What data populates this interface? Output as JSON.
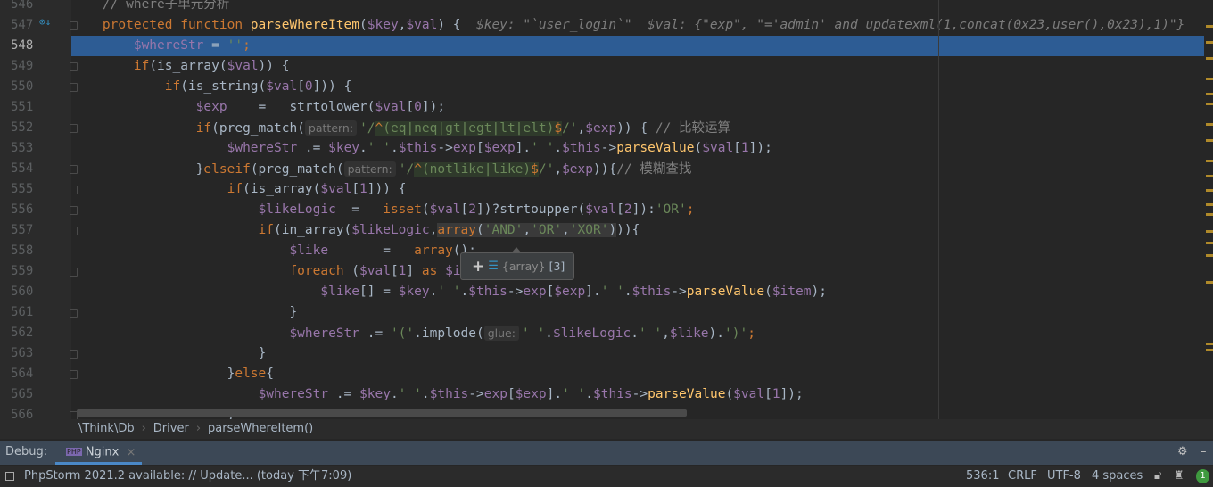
{
  "editor": {
    "first_line": 546,
    "current_line": 548,
    "lines": [
      [
        [
          "    ",
          ""
        ],
        [
          "// where子单元分析",
          "cm"
        ]
      ],
      [
        [
          "    ",
          ""
        ],
        [
          "protected function ",
          "kw"
        ],
        [
          "parseWhereItem",
          "fn"
        ],
        [
          "(",
          ""
        ],
        [
          "$key",
          "v"
        ],
        [
          ",",
          ""
        ],
        [
          "$val",
          "v"
        ],
        [
          ") {",
          ""
        ],
        [
          "  $key: \"`user_login`\"  $val: {\"exp\", \"='admin' and updatexml(1,concat(0x23,user(),0x23),1)\"}",
          "dbg"
        ]
      ],
      [
        [
          "        ",
          ""
        ],
        [
          "$whereStr",
          "v"
        ],
        [
          " = ",
          ""
        ],
        [
          "''",
          "s"
        ],
        [
          ";",
          "kw"
        ]
      ],
      [
        [
          "        ",
          ""
        ],
        [
          "if",
          "kw"
        ],
        [
          "(is_array(",
          ""
        ],
        [
          "$val",
          "v"
        ],
        [
          ")) {",
          ""
        ]
      ],
      [
        [
          "            ",
          ""
        ],
        [
          "if",
          "kw"
        ],
        [
          "(is_string(",
          ""
        ],
        [
          "$val",
          "v"
        ],
        [
          "[",
          ""
        ],
        [
          "0",
          "v"
        ],
        [
          "])) {",
          ""
        ]
      ],
      [
        [
          "                ",
          ""
        ],
        [
          "$exp",
          "v"
        ],
        [
          "    =   strtolower(",
          ""
        ],
        [
          "$val",
          "v"
        ],
        [
          "[",
          ""
        ],
        [
          "0",
          "v"
        ],
        [
          "]);",
          ""
        ]
      ],
      [
        [
          "                ",
          ""
        ],
        [
          "if",
          "kw"
        ],
        [
          "(preg_match(",
          ""
        ],
        [
          "pattern:",
          "hint"
        ],
        [
          "'/",
          "s"
        ],
        [
          "^",
          "rxo"
        ],
        [
          "(eq|neq|gt|egt|lt|elt)",
          "rx"
        ],
        [
          "$",
          "rxo"
        ],
        [
          "/'",
          "s"
        ],
        [
          ",",
          ""
        ],
        [
          "$exp",
          "v"
        ],
        [
          ")) { ",
          ""
        ],
        [
          "// 比较运算",
          "cm"
        ]
      ],
      [
        [
          "                    ",
          ""
        ],
        [
          "$whereStr",
          "v"
        ],
        [
          " .= ",
          ""
        ],
        [
          "$key",
          "v"
        ],
        [
          ".",
          ""
        ],
        [
          "' '",
          "s"
        ],
        [
          ".",
          ""
        ],
        [
          "$this",
          "v"
        ],
        [
          "->",
          ""
        ],
        [
          "exp",
          "v"
        ],
        [
          "[",
          ""
        ],
        [
          "$exp",
          "v"
        ],
        [
          "].",
          ""
        ],
        [
          "' '",
          "s"
        ],
        [
          ".",
          ""
        ],
        [
          "$this",
          "v"
        ],
        [
          "->",
          ""
        ],
        [
          "parseValue",
          "fn"
        ],
        [
          "(",
          ""
        ],
        [
          "$val",
          "v"
        ],
        [
          "[",
          ""
        ],
        [
          "1",
          "v"
        ],
        [
          "]);",
          ""
        ]
      ],
      [
        [
          "                ",
          ""
        ],
        [
          "}",
          ""
        ],
        [
          "elseif",
          "kw"
        ],
        [
          "(preg_match(",
          ""
        ],
        [
          "pattern:",
          "hint"
        ],
        [
          "'/",
          "s"
        ],
        [
          "^",
          "rxo"
        ],
        [
          "(notlike|like)",
          "rx"
        ],
        [
          "$",
          "rxo"
        ],
        [
          "/'",
          "s"
        ],
        [
          ",",
          ""
        ],
        [
          "$exp",
          "v"
        ],
        [
          ")){",
          ""
        ],
        [
          "// 模糊查找",
          "cm"
        ]
      ],
      [
        [
          "                    ",
          ""
        ],
        [
          "if",
          "kw"
        ],
        [
          "(is_array(",
          ""
        ],
        [
          "$val",
          "v"
        ],
        [
          "[",
          ""
        ],
        [
          "1",
          "v"
        ],
        [
          "])) {",
          ""
        ]
      ],
      [
        [
          "                        ",
          ""
        ],
        [
          "$likeLogic",
          "v"
        ],
        [
          "  =   ",
          ""
        ],
        [
          "isset",
          "kw"
        ],
        [
          "(",
          ""
        ],
        [
          "$val",
          "v"
        ],
        [
          "[",
          ""
        ],
        [
          "2",
          "v"
        ],
        [
          "])?strtoupper(",
          ""
        ],
        [
          "$val",
          "v"
        ],
        [
          "[",
          ""
        ],
        [
          "2",
          "v"
        ],
        [
          "]):",
          ""
        ],
        [
          "'OR'",
          "s"
        ],
        [
          ";",
          "kw"
        ]
      ],
      [
        [
          "                        ",
          ""
        ],
        [
          "if",
          "kw"
        ],
        [
          "(in_array(",
          ""
        ],
        [
          "$likeLogic",
          "v"
        ],
        [
          ",",
          ""
        ],
        [
          "array",
          "kw hl"
        ],
        [
          "(",
          "hl"
        ],
        [
          "'AND'",
          "s hl"
        ],
        [
          ",",
          "hl"
        ],
        [
          "'OR'",
          "s hl"
        ],
        [
          ",",
          "hl"
        ],
        [
          "'XOR'",
          "s hl"
        ],
        [
          ")",
          "hl"
        ],
        [
          ")){",
          ""
        ]
      ],
      [
        [
          "                            ",
          ""
        ],
        [
          "$like",
          "v"
        ],
        [
          "       =   ",
          ""
        ],
        [
          "array",
          "kw"
        ],
        [
          "();",
          ""
        ]
      ],
      [
        [
          "                            ",
          ""
        ],
        [
          "foreach",
          "kw"
        ],
        [
          " (",
          ""
        ],
        [
          "$val",
          "v"
        ],
        [
          "[",
          ""
        ],
        [
          "1",
          "v"
        ],
        [
          "] ",
          ""
        ],
        [
          "as",
          "kw"
        ],
        [
          " ",
          ""
        ],
        [
          "$item",
          "v"
        ],
        [
          ") {",
          ""
        ]
      ],
      [
        [
          "                                ",
          ""
        ],
        [
          "$like",
          "v"
        ],
        [
          "[] = ",
          ""
        ],
        [
          "$key",
          "v"
        ],
        [
          ".",
          ""
        ],
        [
          "' '",
          "s"
        ],
        [
          ".",
          ""
        ],
        [
          "$this",
          "v"
        ],
        [
          "->",
          ""
        ],
        [
          "exp",
          "v"
        ],
        [
          "[",
          ""
        ],
        [
          "$exp",
          "v"
        ],
        [
          "].",
          ""
        ],
        [
          "' '",
          "s"
        ],
        [
          ".",
          ""
        ],
        [
          "$this",
          "v"
        ],
        [
          "->",
          ""
        ],
        [
          "parseValue",
          "fn"
        ],
        [
          "(",
          ""
        ],
        [
          "$item",
          "v"
        ],
        [
          ");",
          ""
        ]
      ],
      [
        [
          "                            ",
          ""
        ],
        [
          "}",
          ""
        ]
      ],
      [
        [
          "                            ",
          ""
        ],
        [
          "$whereStr",
          "v"
        ],
        [
          " .= ",
          ""
        ],
        [
          "'('",
          "s"
        ],
        [
          ".implode(",
          ""
        ],
        [
          "glue:",
          "hint"
        ],
        [
          "' '",
          "s"
        ],
        [
          ".",
          ""
        ],
        [
          "$likeLogic",
          "v"
        ],
        [
          ".",
          ""
        ],
        [
          "' '",
          "s"
        ],
        [
          ",",
          ""
        ],
        [
          "$like",
          "v"
        ],
        [
          ").",
          ""
        ],
        [
          "')'",
          "s"
        ],
        [
          ";",
          "kw"
        ]
      ],
      [
        [
          "                        ",
          ""
        ],
        [
          "}",
          ""
        ]
      ],
      [
        [
          "                    ",
          ""
        ],
        [
          "}",
          ""
        ],
        [
          "else",
          "kw"
        ],
        [
          "{",
          ""
        ]
      ],
      [
        [
          "                        ",
          ""
        ],
        [
          "$whereStr",
          "v"
        ],
        [
          " .= ",
          ""
        ],
        [
          "$key",
          "v"
        ],
        [
          ".",
          ""
        ],
        [
          "' '",
          "s"
        ],
        [
          ".",
          ""
        ],
        [
          "$this",
          "v"
        ],
        [
          "->",
          ""
        ],
        [
          "exp",
          "v"
        ],
        [
          "[",
          ""
        ],
        [
          "$exp",
          "v"
        ],
        [
          "].",
          ""
        ],
        [
          "' '",
          "s"
        ],
        [
          ".",
          ""
        ],
        [
          "$this",
          "v"
        ],
        [
          "->",
          ""
        ],
        [
          "parseValue",
          "fn"
        ],
        [
          "(",
          ""
        ],
        [
          "$val",
          "v"
        ],
        [
          "[",
          ""
        ],
        [
          "1",
          "v"
        ],
        [
          "]);",
          ""
        ]
      ],
      [
        [
          "                    ",
          ""
        ],
        [
          "}",
          ""
        ]
      ]
    ],
    "folds": [
      547,
      549,
      550,
      552,
      554,
      555,
      556,
      557,
      559,
      561,
      563,
      564,
      566
    ]
  },
  "tooltip": {
    "plus": "+",
    "value": "{array}",
    "count": "[3]"
  },
  "breadcrumb": {
    "items": [
      "\\Think\\Db",
      "Driver",
      "parseWhereItem()"
    ]
  },
  "debug": {
    "label": "Debug:",
    "tab": "Nginx",
    "close": "×"
  },
  "status": {
    "message": "PhpStorm 2021.2 available: // Update... (today 下午7:09)",
    "position": "536:1",
    "line_sep": "CRLF",
    "encoding": "UTF-8",
    "indent": "4 spaces",
    "notifications": "1"
  },
  "colors": {
    "accent": "#4a88c7",
    "current_line": "#2d5c94"
  }
}
